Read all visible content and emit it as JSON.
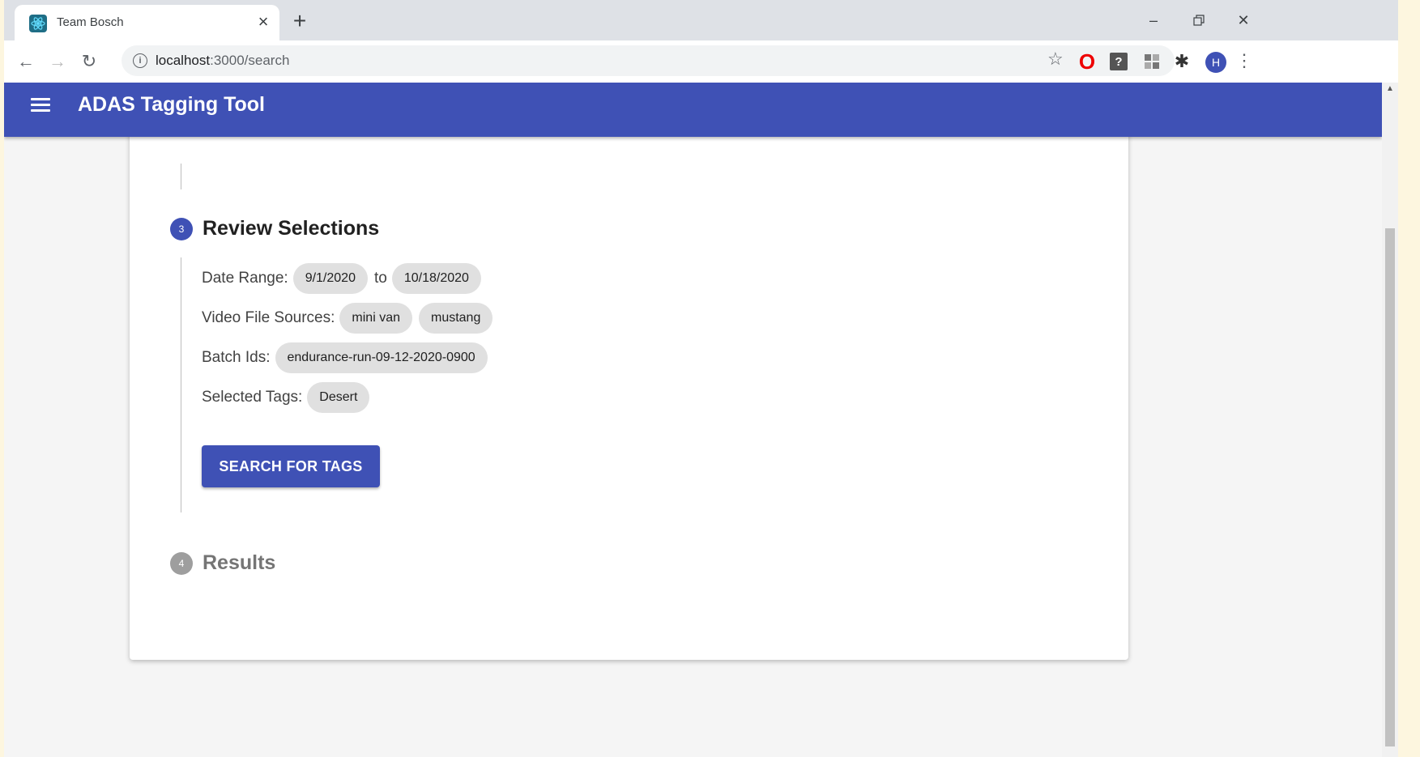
{
  "browser": {
    "tab_title": "Team Bosch",
    "url_host": "localhost",
    "url_rest": ":3000/search"
  },
  "app": {
    "title": "ADAS Tagging Tool"
  },
  "stepper": {
    "review": {
      "number": "3",
      "label": "Review Selections",
      "date_range_label": "Date Range:",
      "date_from": "9/1/2020",
      "to_text": "to",
      "date_to": "10/18/2020",
      "video_sources_label": "Video File Sources:",
      "video_sources": [
        "mini van",
        "mustang"
      ],
      "batch_ids_label": "Batch Ids:",
      "batch_ids": [
        "endurance-run-09-12-2020-0900"
      ],
      "tags_label": "Selected Tags:",
      "tags": [
        "Desert"
      ],
      "search_button": "SEARCH FOR TAGS"
    },
    "results": {
      "number": "4",
      "label": "Results"
    }
  },
  "colors": {
    "primary": "#3f51b5",
    "chip": "#e0e0e0",
    "inactive_step": "#9e9e9e"
  },
  "icons": [
    "react-favicon-icon",
    "close-icon",
    "plus-icon",
    "minimize-icon",
    "restore-icon",
    "close-window-icon",
    "back-icon",
    "forward-icon",
    "reload-icon",
    "info-icon",
    "star-icon",
    "opera-icon",
    "extension-q-icon",
    "extension-grid-icon",
    "puzzle-icon",
    "avatar",
    "kebab-icon",
    "menu-icon"
  ]
}
